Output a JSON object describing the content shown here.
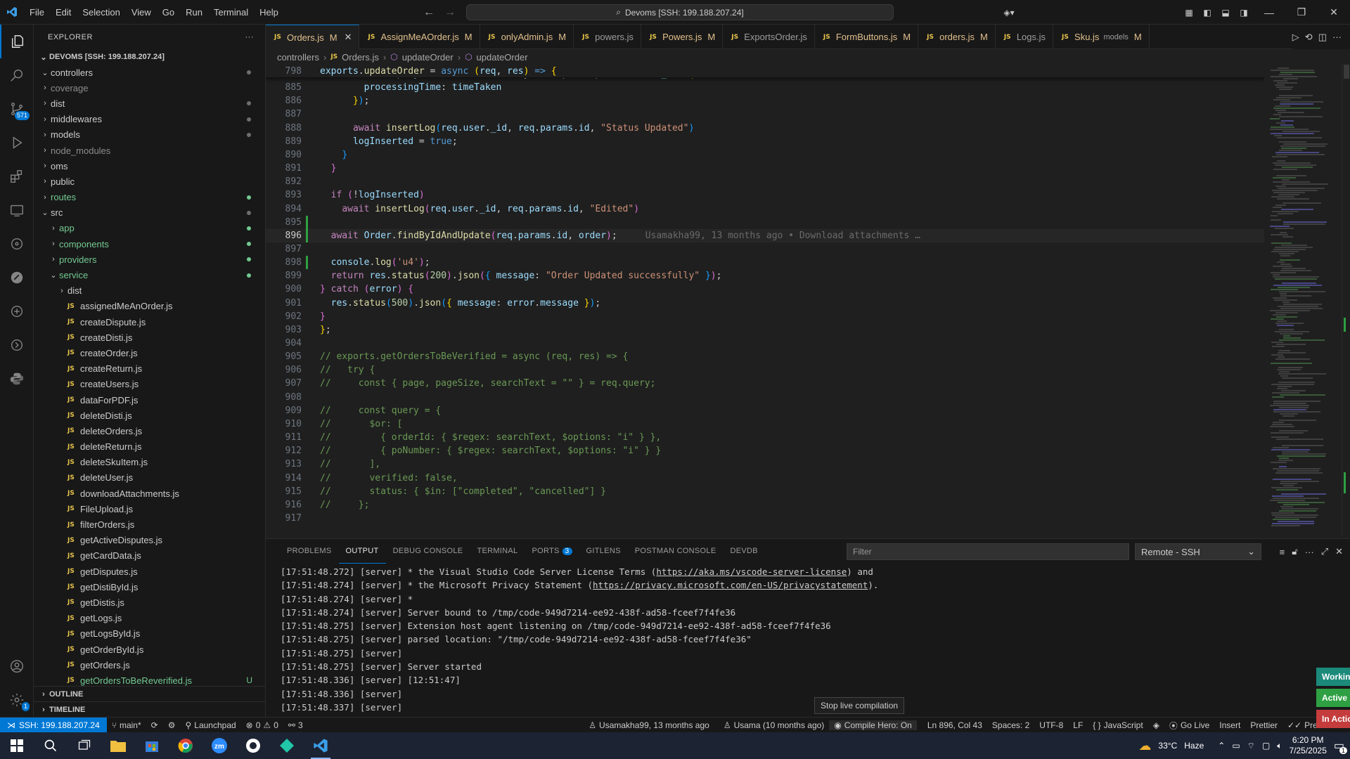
{
  "titlebar": {
    "menu": [
      "File",
      "Edit",
      "Selection",
      "View",
      "Go",
      "Run",
      "Terminal",
      "Help"
    ],
    "command_center": "Devoms [SSH: 199.188.207.24]"
  },
  "activity": {
    "source_control_badge": "571"
  },
  "sidebar": {
    "header": "EXPLORER",
    "root": "DEVOMS [SSH: 199.188.207.24]",
    "items": [
      {
        "label": "controllers",
        "type": "folder-open",
        "depth": 1,
        "dot": true
      },
      {
        "label": "coverage",
        "type": "folder",
        "depth": 1,
        "gray": true
      },
      {
        "label": "dist",
        "type": "folder",
        "depth": 1,
        "dot": true
      },
      {
        "label": "middlewares",
        "type": "folder",
        "depth": 1,
        "dot": true
      },
      {
        "label": "models",
        "type": "folder",
        "depth": 1,
        "dot": true
      },
      {
        "label": "node_modules",
        "type": "folder",
        "depth": 1,
        "gray": true
      },
      {
        "label": "oms",
        "type": "folder",
        "depth": 1
      },
      {
        "label": "public",
        "type": "folder",
        "depth": 1
      },
      {
        "label": "routes",
        "type": "folder",
        "depth": 1,
        "dot": true,
        "mod": true
      },
      {
        "label": "src",
        "type": "folder-open",
        "depth": 1,
        "dot": true
      },
      {
        "label": "app",
        "type": "folder",
        "depth": 2,
        "dot": true,
        "mod": true
      },
      {
        "label": "components",
        "type": "folder",
        "depth": 2,
        "dot": true,
        "mod": true
      },
      {
        "label": "providers",
        "type": "folder",
        "depth": 2,
        "dot": true,
        "mod": true
      },
      {
        "label": "service",
        "type": "folder-open",
        "depth": 2,
        "dot": true,
        "mod": true
      },
      {
        "label": "dist",
        "type": "folder",
        "depth": 3
      },
      {
        "label": "assignedMeAnOrder.js",
        "type": "file",
        "depth": 3
      },
      {
        "label": "createDispute.js",
        "type": "file",
        "depth": 3
      },
      {
        "label": "createDisti.js",
        "type": "file",
        "depth": 3
      },
      {
        "label": "createOrder.js",
        "type": "file",
        "depth": 3
      },
      {
        "label": "createReturn.js",
        "type": "file",
        "depth": 3
      },
      {
        "label": "createUsers.js",
        "type": "file",
        "depth": 3
      },
      {
        "label": "dataForPDF.js",
        "type": "file",
        "depth": 3
      },
      {
        "label": "deleteDisti.js",
        "type": "file",
        "depth": 3
      },
      {
        "label": "deleteOrders.js",
        "type": "file",
        "depth": 3
      },
      {
        "label": "deleteReturn.js",
        "type": "file",
        "depth": 3
      },
      {
        "label": "deleteSkuItem.js",
        "type": "file",
        "depth": 3
      },
      {
        "label": "deleteUser.js",
        "type": "file",
        "depth": 3
      },
      {
        "label": "downloadAttachments.js",
        "type": "file",
        "depth": 3
      },
      {
        "label": "FileUpload.js",
        "type": "file",
        "depth": 3
      },
      {
        "label": "filterOrders.js",
        "type": "file",
        "depth": 3
      },
      {
        "label": "getActiveDisputes.js",
        "type": "file",
        "depth": 3
      },
      {
        "label": "getCardData.js",
        "type": "file",
        "depth": 3
      },
      {
        "label": "getDisputes.js",
        "type": "file",
        "depth": 3
      },
      {
        "label": "getDistiById.js",
        "type": "file",
        "depth": 3
      },
      {
        "label": "getDistis.js",
        "type": "file",
        "depth": 3
      },
      {
        "label": "getLogs.js",
        "type": "file",
        "depth": 3
      },
      {
        "label": "getLogsById.js",
        "type": "file",
        "depth": 3
      },
      {
        "label": "getOrderById.js",
        "type": "file",
        "depth": 3
      },
      {
        "label": "getOrders.js",
        "type": "file",
        "depth": 3
      },
      {
        "label": "getOrdersToBeReverified.js",
        "type": "file",
        "depth": 3,
        "mod": true,
        "badge": "U"
      }
    ],
    "outline": "OUTLINE",
    "timeline": "TIMELINE"
  },
  "tabs": [
    {
      "label": "Orders.js",
      "flag": "M",
      "active": true
    },
    {
      "label": "AssignMeAOrder.js",
      "flag": "M"
    },
    {
      "label": "onlyAdmin.js",
      "flag": "M"
    },
    {
      "label": "powers.js",
      "flag": ""
    },
    {
      "label": "Powers.js",
      "flag": "M"
    },
    {
      "label": "ExportsOrder.js",
      "flag": ""
    },
    {
      "label": "FormButtons.js",
      "flag": "M"
    },
    {
      "label": "orders.js",
      "flag": "M"
    },
    {
      "label": "Logs.js",
      "flag": ""
    },
    {
      "label": "Sku.js",
      "flag": "M",
      "sub": "models"
    }
  ],
  "breadcrumb": [
    "controllers",
    "Orders.js",
    "updateOrder",
    "updateOrder"
  ],
  "editor": {
    "sticky_line": {
      "num": "798",
      "html": "<span class='v'>exports</span>.<span class='f'>updateOrder</span> = <span class='kb'>async</span> <span class='p'>(</span><span class='v'>req</span>, <span class='v'>res</span><span class='p'>)</span> <span class='kb'>=&gt;</span> <span class='p'>{</span>"
    },
    "lines": [
      {
        "num": "884",
        "html": "      <span class='k'>await</span> <span class='v'>EmployeePerformance</span>.<span class='f'>findByIdAndUpdate</span><span class='p3'>(</span><span class='v'>performance</span>.<span class='v'>_id</span>, <span class='p'>{</span>"
      },
      {
        "num": "885",
        "html": "        <span class='v'>processingTime</span>: <span class='v'>timeTaken</span>"
      },
      {
        "num": "886",
        "html": "      <span class='p'>}</span><span class='p3'>)</span>;"
      },
      {
        "num": "887",
        "html": ""
      },
      {
        "num": "888",
        "html": "      <span class='k'>await</span> <span class='f'>insertLog</span><span class='p3'>(</span><span class='v'>req</span>.<span class='v'>user</span>.<span class='v'>_id</span>, <span class='v'>req</span>.<span class='v'>params</span>.<span class='v'>id</span>, <span class='s'>\"Status Updated\"</span><span class='p3'>)</span>"
      },
      {
        "num": "889",
        "html": "      <span class='v'>logInserted</span> = <span class='kb'>true</span>;"
      },
      {
        "num": "890",
        "html": "    <span class='p3'>}</span>"
      },
      {
        "num": "891",
        "html": "  <span class='p2'>}</span>"
      },
      {
        "num": "892",
        "html": ""
      },
      {
        "num": "893",
        "html": "  <span class='k'>if</span> <span class='p2'>(</span>!<span class='v'>logInserted</span><span class='p2'>)</span>"
      },
      {
        "num": "894",
        "html": "    <span class='k'>await</span> <span class='f'>insertLog</span><span class='p2'>(</span><span class='v'>req</span>.<span class='v'>user</span>.<span class='v'>_id</span>, <span class='v'>req</span>.<span class='v'>params</span>.<span class='v'>id</span>, <span class='s'>\"Edited\"</span><span class='p2'>)</span>"
      },
      {
        "num": "895",
        "html": ""
      },
      {
        "num": "896",
        "html": "  <span class='k'>await</span> <span class='v'>Order</span>.<span class='f'>findByIdAndUpdate</span><span class='p2'>(</span><span class='v'>req</span>.<span class='v'>params</span>.<span class='v'>id</span>, <span class='v'>order</span><span class='p2'>)</span>;<span class='blame'>Usamakha99, 13 months ago • Download attachments …</span>",
        "current": true
      },
      {
        "num": "897",
        "html": ""
      },
      {
        "num": "898",
        "html": "  <span class='v'>console</span>.<span class='f'>log</span><span class='p2'>(</span><span class='s'>'u4'</span><span class='p2'>)</span>;"
      },
      {
        "num": "899",
        "html": "  <span class='k'>return</span> <span class='v'>res</span>.<span class='f'>status</span><span class='p2'>(</span><span class='n'>200</span><span class='p2'>)</span>.<span class='f'>json</span><span class='p2'>(</span><span class='p3'>{</span> <span class='v'>message</span>: <span class='s'>\"Order Updated successfully\"</span> <span class='p3'>}</span><span class='p2'>)</span>;"
      },
      {
        "num": "900",
        "html": "<span class='p2'>}</span> <span class='k'>catch</span> <span class='p2'>(</span><span class='v'>error</span><span class='p2'>)</span> <span class='p2'>{</span>"
      },
      {
        "num": "901",
        "html": "  <span class='v'>res</span>.<span class='f'>status</span><span class='p3'>(</span><span class='n'>500</span><span class='p3'>)</span>.<span class='f'>json</span><span class='p3'>(</span><span class='p'>{</span> <span class='v'>message</span>: <span class='v'>error</span>.<span class='v'>message</span> <span class='p'>}</span><span class='p3'>)</span>;"
      },
      {
        "num": "902",
        "html": "<span class='p2'>}</span>"
      },
      {
        "num": "903",
        "html": "<span class='p'>}</span>;"
      },
      {
        "num": "904",
        "html": ""
      },
      {
        "num": "905",
        "html": "<span class='c'>// exports.getOrdersToBeVerified = async (req, res) =&gt; {</span>"
      },
      {
        "num": "906",
        "html": "<span class='c'>//   try {</span>"
      },
      {
        "num": "907",
        "html": "<span class='c'>//     const { page, pageSize, searchText = \"\" } = req.query;</span>"
      },
      {
        "num": "908",
        "html": ""
      },
      {
        "num": "909",
        "html": "<span class='c'>//     const query = {</span>"
      },
      {
        "num": "910",
        "html": "<span class='c'>//       $or: [</span>"
      },
      {
        "num": "911",
        "html": "<span class='c'>//         { orderId: { $regex: searchText, $options: \"i\" } },</span>"
      },
      {
        "num": "912",
        "html": "<span class='c'>//         { poNumber: { $regex: searchText, $options: \"i\" } }</span>"
      },
      {
        "num": "913",
        "html": "<span class='c'>//       ],</span>"
      },
      {
        "num": "914",
        "html": "<span class='c'>//       verified: false,</span>"
      },
      {
        "num": "915",
        "html": "<span class='c'>//       status: { $in: [\"completed\", \"cancelled\"] }</span>"
      },
      {
        "num": "916",
        "html": "<span class='c'>//     };</span>"
      },
      {
        "num": "917",
        "html": ""
      }
    ]
  },
  "panel": {
    "tabs": [
      {
        "label": "PROBLEMS"
      },
      {
        "label": "OUTPUT",
        "active": true
      },
      {
        "label": "DEBUG CONSOLE"
      },
      {
        "label": "TERMINAL"
      },
      {
        "label": "PORTS",
        "badge": "3"
      },
      {
        "label": "GITLENS"
      },
      {
        "label": "POSTMAN CONSOLE"
      },
      {
        "label": "DEVDB"
      }
    ],
    "filter_placeholder": "Filter",
    "channel": "Remote - SSH",
    "output": [
      "[17:51:48.272] [server] * the Visual Studio Code Server License Terms (<u>https://aka.ms/vscode-server-license</u>) and",
      "[17:51:48.274] [server] * the Microsoft Privacy Statement (<u>https://privacy.microsoft.com/en-US/privacystatement</u>).",
      "[17:51:48.274] [server] *",
      "[17:51:48.274] [server] Server bound to /tmp/code-949d7214-ee92-438f-ad58-fceef7f4fe36",
      "[17:51:48.275] [server] Extension host agent listening on /tmp/code-949d7214-ee92-438f-ad58-fceef7f4fe36",
      "[17:51:48.275] [server] parsed location: \"/tmp/code-949d7214-ee92-438f-ad58-fceef7f4fe36\"",
      "[17:51:48.275] [server]",
      "[17:51:48.275] [server] Server started",
      "[17:51:48.336] [server] [12:51:47]",
      "[17:51:48.336] [server]",
      "[17:51:48.337] [server]"
    ],
    "tooltip": "Stop live compilation",
    "toasts": [
      "Working",
      "Active",
      "In Action"
    ]
  },
  "statusbar": {
    "remote": "SSH: 199.188.207.24",
    "branch": "main*",
    "launchpad": "Launchpad",
    "errors": "0",
    "warnings": "0",
    "ports": "3",
    "blame_line": "Usamakha99, 13 months ago",
    "blame_author": "Usama (10 months ago)",
    "compile_hero": "Compile Hero: On",
    "cursor": "Ln 896, Col 43",
    "spaces": "Spaces: 2",
    "encoding": "UTF-8",
    "eol": "LF",
    "language": "JavaScript",
    "golive": "Go Live",
    "insert": "Insert",
    "prettier": "Prettier",
    "prettier2": "Prettier"
  },
  "taskbar": {
    "weather": "33°C",
    "weather_desc": "Haze",
    "time": "6:20 PM",
    "date": "7/25/2025",
    "notif_count": "1"
  },
  "colors": {
    "accent": "#0078d4",
    "git_added": "#2ea043",
    "modified": "#e2c08d",
    "untracked": "#73c991"
  }
}
